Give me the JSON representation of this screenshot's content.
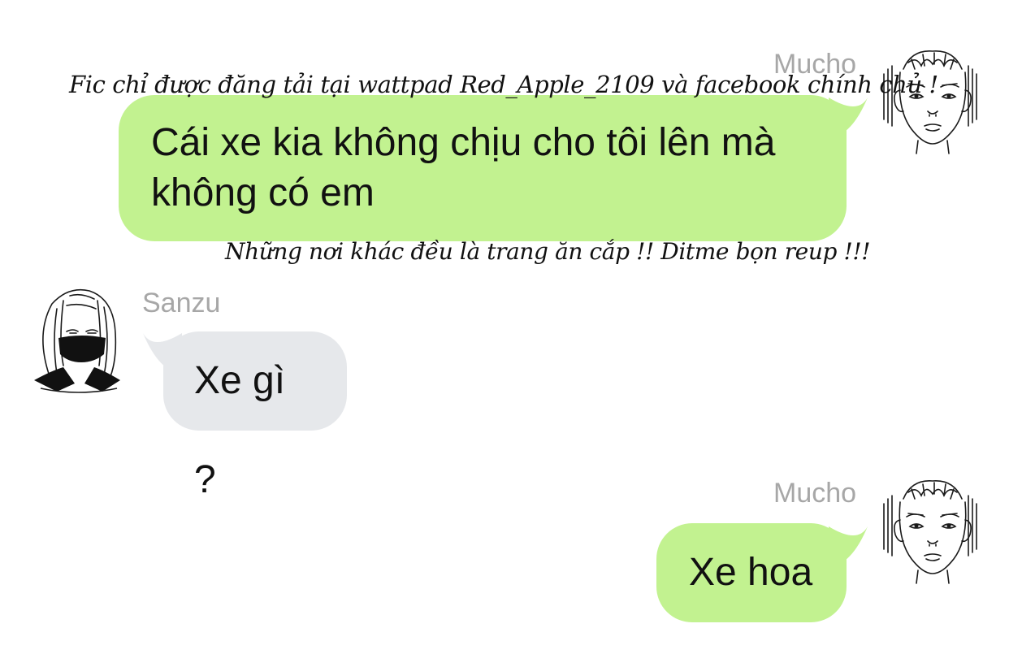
{
  "watermark": {
    "top_line": "Fic chỉ được đăng tải tại wattpad Red_Apple_2109 và facebook chính chủ !",
    "bottom_line": "Những nơi khác đều là trang ăn cắp !! Ditme bọn reup !!!"
  },
  "messages": [
    {
      "sender": "Mucho",
      "side": "right",
      "text": "Cái xe kia không chịu cho tôi lên mà\nkhông có em",
      "bubble_color": "#c2f290",
      "avatar": "mucho-avatar"
    },
    {
      "sender": "Sanzu",
      "side": "left",
      "text": "Xe gì ?",
      "bubble_color": "#e6e8eb",
      "avatar": "sanzu-avatar"
    },
    {
      "sender": "Mucho",
      "side": "right",
      "text": "Xe hoa",
      "bubble_color": "#c2f290",
      "avatar": "mucho-avatar"
    }
  ],
  "colors": {
    "sender_name": "#a7a7a7",
    "outgoing_bubble": "#c2f290",
    "incoming_bubble": "#e6e8eb"
  }
}
